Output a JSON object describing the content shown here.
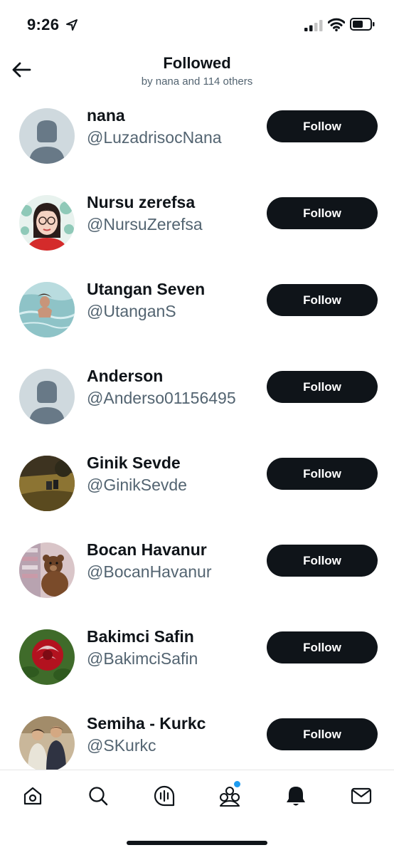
{
  "status_bar": {
    "time": "9:26"
  },
  "header": {
    "title": "Followed",
    "subtitle": "by nana and 114 others"
  },
  "users": [
    {
      "name": "nana",
      "handle": "@LuzadrisocNana",
      "button": "Follow",
      "avatar": "default-silhouette"
    },
    {
      "name": "Nursu zerefsa",
      "handle": "@NursuZerefsa",
      "button": "Follow",
      "avatar": "cartoon-woman-glasses"
    },
    {
      "name": "Utangan Seven",
      "handle": "@UtanganS",
      "button": "Follow",
      "avatar": "person-in-pool"
    },
    {
      "name": "Anderson",
      "handle": "@Anderso01156495",
      "button": "Follow",
      "avatar": "default-silhouette"
    },
    {
      "name": "Ginik Sevde",
      "handle": "@GinikSevde",
      "button": "Follow",
      "avatar": "park-photo"
    },
    {
      "name": "Bocan Havanur",
      "handle": "@BocanHavanur",
      "button": "Follow",
      "avatar": "teddy-bear"
    },
    {
      "name": "Bakimci Safin",
      "handle": "@BakimciSafin",
      "button": "Follow",
      "avatar": "red-rose"
    },
    {
      "name": "Semiha - Kurkc",
      "handle": "@SKurkc",
      "button": "Follow",
      "avatar": "couple-photo"
    }
  ],
  "tab_bar": {
    "tabs": [
      "home-icon",
      "search-icon",
      "spaces-icon",
      "communities-icon",
      "notifications-icon",
      "messages-icon"
    ],
    "active": "notifications-icon",
    "dot_color": "#1d9bf0"
  },
  "colors": {
    "text": "#0f1419",
    "secondary_text": "#536471",
    "follow_button_bg": "#0f1419",
    "follow_button_text": "#ffffff"
  }
}
